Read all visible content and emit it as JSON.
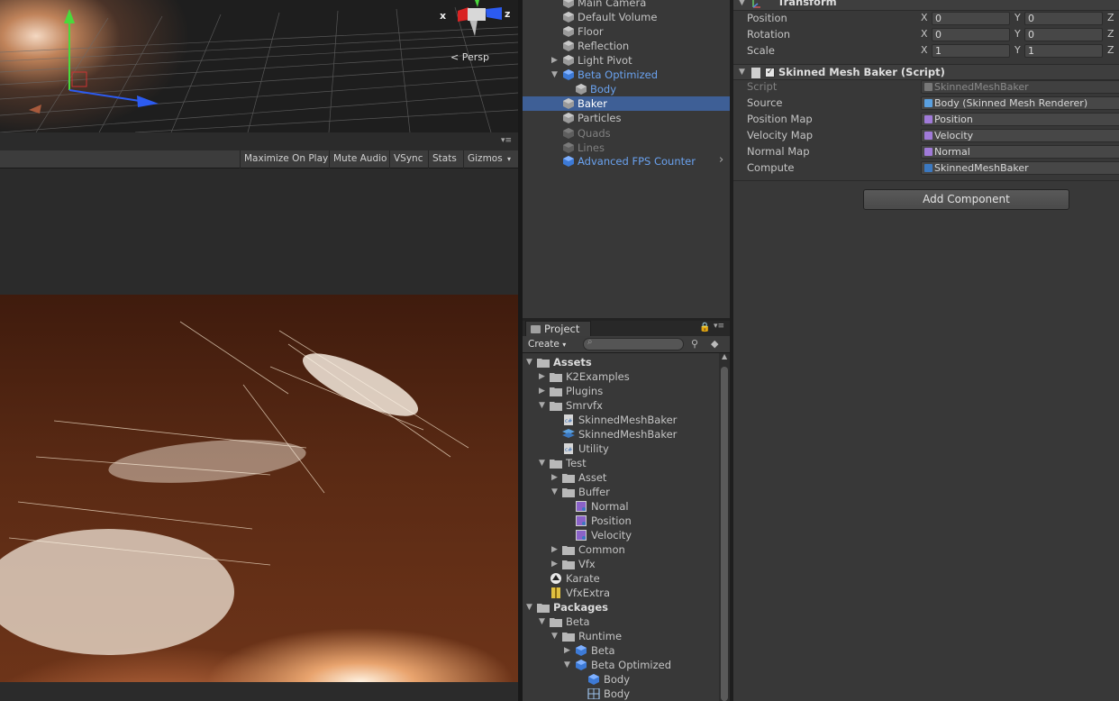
{
  "scene": {
    "projection_label": "< Persp",
    "gizmo_x": "x",
    "gizmo_z": "z"
  },
  "game_toolbar": {
    "maximize": "Maximize On Play",
    "mute": "Mute Audio",
    "vsync": "VSync",
    "stats": "Stats",
    "gizmos": "Gizmos"
  },
  "hierarchy": {
    "items": [
      {
        "label": "Main Camera",
        "style": "normal",
        "selected": false
      },
      {
        "label": "Default Volume",
        "style": "normal",
        "selected": false
      },
      {
        "label": "Floor",
        "style": "normal",
        "selected": false
      },
      {
        "label": "Reflection",
        "style": "normal",
        "selected": false
      },
      {
        "label": "Light Pivot",
        "style": "normal",
        "selected": false
      },
      {
        "label": "Beta Optimized",
        "style": "prefab",
        "selected": false
      },
      {
        "label": "Body",
        "style": "prefab",
        "selected": false
      },
      {
        "label": "Baker",
        "style": "normal",
        "selected": true
      },
      {
        "label": "Particles",
        "style": "normal",
        "selected": false
      },
      {
        "label": "Quads",
        "style": "dim",
        "selected": false
      },
      {
        "label": "Lines",
        "style": "dim",
        "selected": false
      },
      {
        "label": "Advanced FPS Counter",
        "style": "prefab",
        "selected": false
      }
    ]
  },
  "project": {
    "tab_label": "Project",
    "create_label": "Create",
    "tree": [
      {
        "label": "Assets",
        "bold": true
      },
      {
        "label": "K2Examples"
      },
      {
        "label": "Plugins"
      },
      {
        "label": "Smrvfx"
      },
      {
        "label": "SkinnedMeshBaker"
      },
      {
        "label": "SkinnedMeshBaker"
      },
      {
        "label": "Utility"
      },
      {
        "label": "Test"
      },
      {
        "label": "Asset"
      },
      {
        "label": "Buffer"
      },
      {
        "label": "Normal"
      },
      {
        "label": "Position"
      },
      {
        "label": "Velocity"
      },
      {
        "label": "Common"
      },
      {
        "label": "Vfx"
      },
      {
        "label": "Karate"
      },
      {
        "label": "VfxExtra"
      },
      {
        "label": "Packages",
        "bold": true
      },
      {
        "label": "Beta"
      },
      {
        "label": "Runtime"
      },
      {
        "label": "Beta"
      },
      {
        "label": "Beta Optimized"
      },
      {
        "label": "Body"
      },
      {
        "label": "Body"
      }
    ]
  },
  "inspector": {
    "transform": {
      "title": "Transform",
      "rows": [
        {
          "label": "Position",
          "x": "0",
          "y": "0"
        },
        {
          "label": "Rotation",
          "x": "0",
          "y": "0"
        },
        {
          "label": "Scale",
          "x": "1",
          "y": "1"
        }
      ],
      "axis_x": "X",
      "axis_y": "Y",
      "axis_z": "Z"
    },
    "baker": {
      "title": "Skinned Mesh Baker (Script)",
      "rows": [
        {
          "label": "Script",
          "value": "SkinnedMeshBaker",
          "readonly": true
        },
        {
          "label": "Source",
          "value": "Body (Skinned Mesh Renderer)"
        },
        {
          "label": "Position Map",
          "value": "Position"
        },
        {
          "label": "Velocity Map",
          "value": "Velocity"
        },
        {
          "label": "Normal Map",
          "value": "Normal"
        },
        {
          "label": "Compute",
          "value": "SkinnedMeshBaker"
        }
      ]
    },
    "add_component": "Add Component"
  }
}
